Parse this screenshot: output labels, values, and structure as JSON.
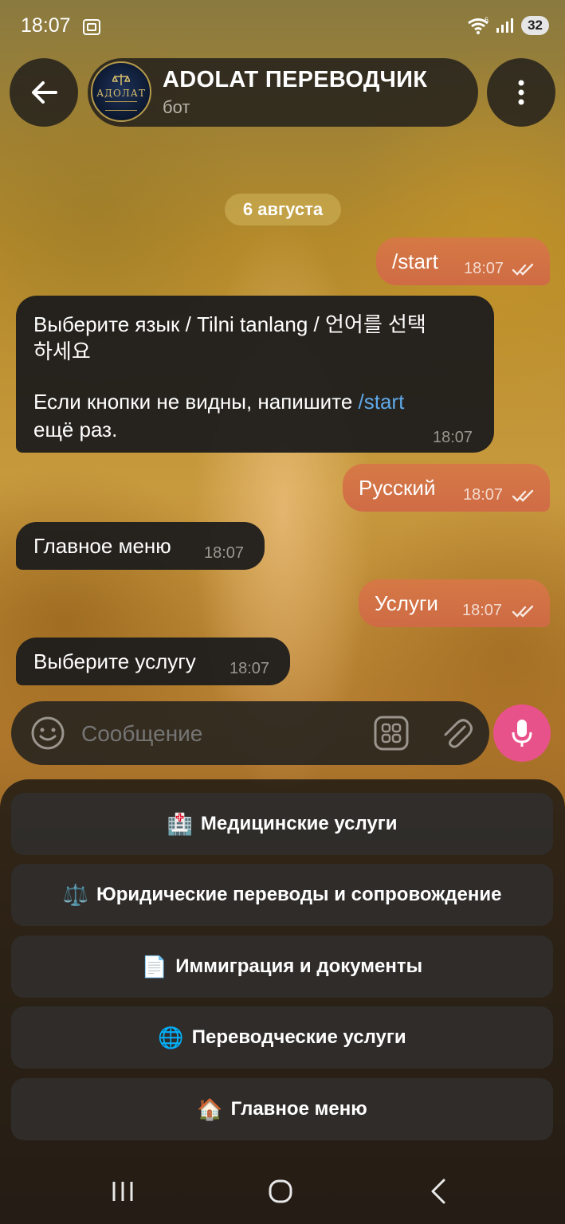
{
  "status_bar": {
    "time": "18:07",
    "battery": "32"
  },
  "header": {
    "title": "ADOLAT ПЕРЕВОДЧИК",
    "subtitle": "бот",
    "avatar_text": "АДОЛАТ"
  },
  "date_chip": "6 августа",
  "messages": [
    {
      "dir": "out",
      "text": "/start",
      "time": "18:07"
    },
    {
      "dir": "in",
      "line1": "Выберите язык / Tilni tanlang / 언어를 선택",
      "line2": "하세요",
      "line3_pre": "Если кнопки не видны, напишите ",
      "line3_link": "/start",
      "line4": "ещё раз.",
      "time": "18:07"
    },
    {
      "dir": "out",
      "text": "Русский",
      "time": "18:07"
    },
    {
      "dir": "in",
      "text": "Главное меню",
      "time": "18:07"
    },
    {
      "dir": "out",
      "text": "Услуги",
      "time": "18:07"
    },
    {
      "dir": "in",
      "text": "Выберите услугу",
      "time": "18:07"
    }
  ],
  "composer": {
    "placeholder": "Сообщение"
  },
  "keyboard": [
    {
      "emoji": "🏥",
      "label": "Медицинские услуги"
    },
    {
      "emoji": "⚖️",
      "label": "Юридические переводы и сопровождение"
    },
    {
      "emoji": "📄",
      "label": "Иммиграция и документы"
    },
    {
      "emoji": "🌐",
      "label": "Переводческие услуги"
    },
    {
      "emoji": "🏠",
      "label": "Главное меню"
    }
  ],
  "colors": {
    "out_bubble": "#d2704a",
    "in_bubble": "#1e1c1c",
    "mic": "#e8528a",
    "link": "#5fa8e8"
  }
}
